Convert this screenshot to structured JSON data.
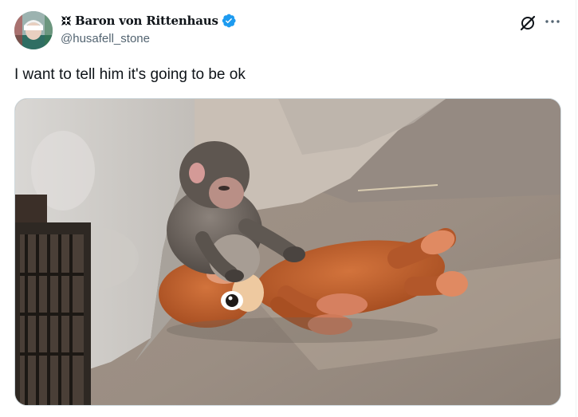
{
  "tweet": {
    "author": {
      "display_name": "Baron von Rittenhaus",
      "handle": "@husafell_stone",
      "verified": true,
      "avatar_icon": "avatar-image",
      "badge_icon": "iron-cross-icon"
    },
    "text": "I want to tell him it's going to be ok",
    "media": {
      "type": "photo",
      "alt": "Baby monkey lying on a stuffed orangutan toy"
    },
    "actions": {
      "grok_icon": "grok-icon",
      "more_icon": "more-icon"
    }
  },
  "colors": {
    "text_primary": "#0f1419",
    "text_secondary": "#536471",
    "verified_blue": "#1d9bf0",
    "border": "#cfd9de"
  }
}
